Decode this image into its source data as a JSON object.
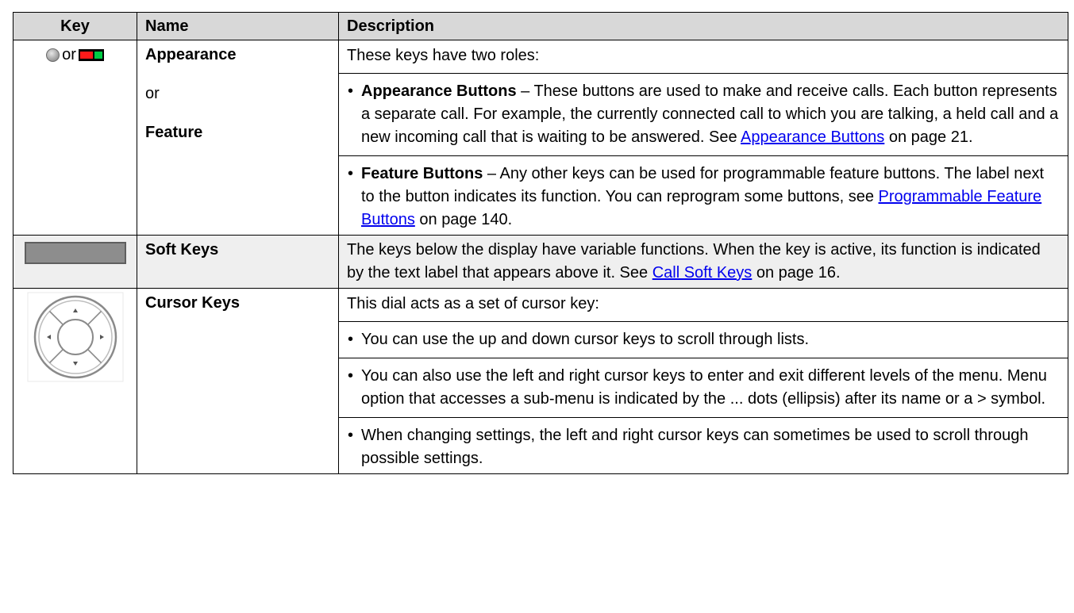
{
  "headers": {
    "key": "Key",
    "name": "Name",
    "description": "Description"
  },
  "rows": [
    {
      "key_or_text": "or",
      "name_parts": [
        "Appearance",
        "or",
        "Feature"
      ],
      "description": {
        "intro": "These keys have two roles:",
        "bullets": [
          {
            "bold": "Appearance Buttons",
            "text_before_link": " – These buttons are used to make and receive calls. Each button represents a separate call. For example, the currently connected call to which you are talking, a held call and a new incoming call that is waiting to be answered. See ",
            "link": "Appearance Buttons",
            "text_after_link": " on page 21."
          },
          {
            "bold": "Feature Buttons",
            "text_before_link": " – Any other keys can be used for programmable feature buttons. The label next to the button indicates its function. You can reprogram some buttons, see ",
            "link": "Programmable Feature Buttons",
            "text_after_link": " on page 140."
          }
        ]
      },
      "icons": [
        "grey-led-icon",
        "red-green-led-icon"
      ]
    },
    {
      "name": "Soft Keys",
      "description": {
        "text_before_link": "The keys below the display have variable functions. When the key is active, its function is indicated by the text label that appears above it. See ",
        "link": "Call Soft Keys",
        "text_after_link": " on page 16."
      },
      "icons": [
        "soft-key-icon"
      ]
    },
    {
      "name": "Cursor Keys",
      "description": {
        "intro": "This dial acts as a set of cursor key:",
        "bullets": [
          "You can use the up and down cursor keys to scroll through lists.",
          "You can also use the left and right cursor keys to enter and exit different levels of the menu. Menu option that accesses a sub-menu is indicated by the ... dots (ellipsis) after its name or a > symbol.",
          "When changing settings, the left and right cursor keys can sometimes be used to scroll through possible settings."
        ]
      },
      "icons": [
        "cursor-dial-icon"
      ]
    }
  ],
  "colors": {
    "header_bg": "#d8d8d8",
    "shaded_row_bg": "#efefef",
    "link": "#0000ee",
    "led_red": "#ff1a1a",
    "led_green": "#00cc44"
  },
  "bullet_glyph": "•"
}
